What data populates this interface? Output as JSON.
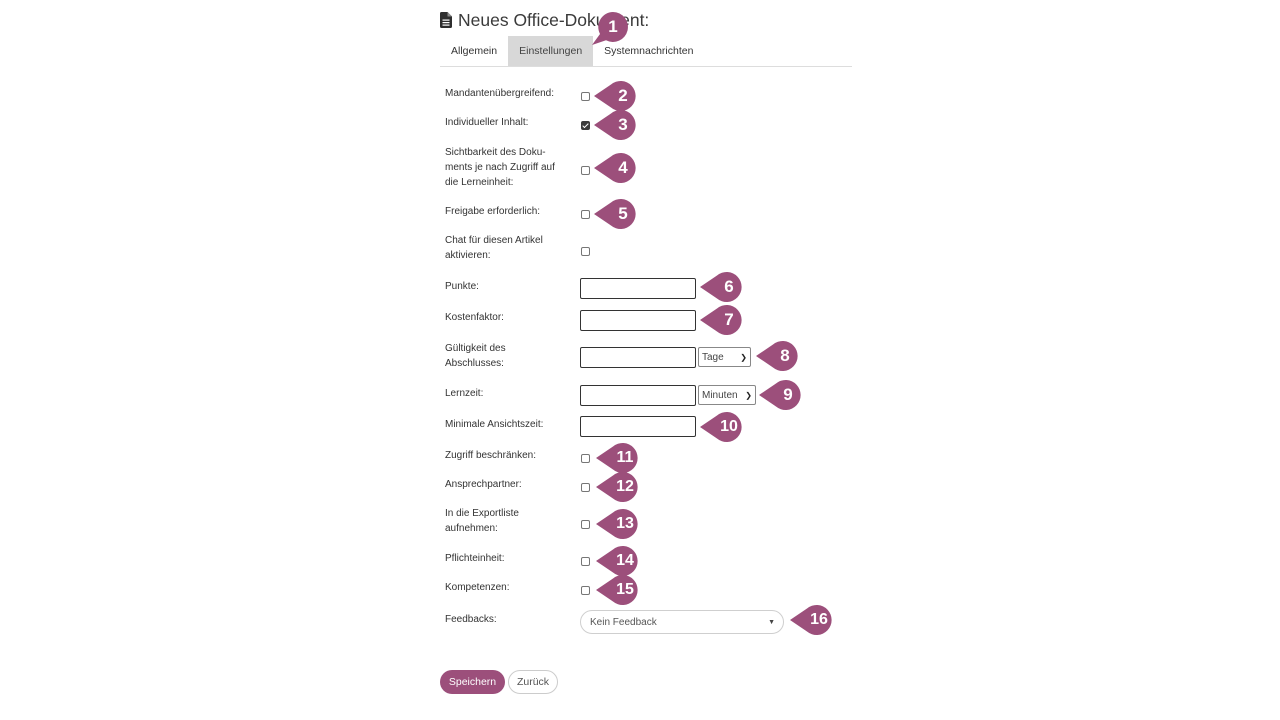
{
  "title": "Neues Office-Dokument:",
  "tabs": [
    {
      "label": "Allgemein"
    },
    {
      "label": "Einstellungen"
    },
    {
      "label": "Systemnachrichten"
    }
  ],
  "fields": {
    "mandanten": {
      "label": "Mandantenübergreifend:",
      "checked": false
    },
    "individuell": {
      "label": "Individueller Inhalt:",
      "checked": true
    },
    "sichtbarkeit": {
      "label": "Sichtbarkeit des Doku-\nments je nach Zugriff auf\ndie Lerneinheit:",
      "checked": false
    },
    "freigabe": {
      "label": "Freigabe erforderlich:",
      "checked": false
    },
    "chat": {
      "label": "Chat für diesen Artikel\naktivieren:",
      "checked": false
    },
    "punkte": {
      "label": "Punkte:",
      "value": ""
    },
    "kostenfaktor": {
      "label": "Kostenfaktor:",
      "value": ""
    },
    "gueltigkeit": {
      "label": "Gültigkeit des\nAbschlusses:",
      "value": "",
      "unit": "Tage"
    },
    "lernzeit": {
      "label": "Lernzeit:",
      "value": "",
      "unit": "Minuten"
    },
    "ansichtszeit": {
      "label": "Minimale Ansichtszeit:",
      "value": ""
    },
    "zugriff": {
      "label": "Zugriff beschränken:",
      "checked": false
    },
    "ansprechpartner": {
      "label": "Ansprechpartner:",
      "checked": false
    },
    "exportliste": {
      "label": "In die Exportliste\naufnehmen:",
      "checked": false
    },
    "pflicht": {
      "label": "Pflichteinheit:",
      "checked": false
    },
    "kompetenzen": {
      "label": "Kompetenzen:",
      "checked": false
    },
    "feedbacks": {
      "label": "Feedbacks:",
      "value": "Kein Feedback"
    }
  },
  "markers": [
    "1",
    "2",
    "3",
    "4",
    "5",
    "6",
    "7",
    "8",
    "9",
    "10",
    "11",
    "12",
    "13",
    "14",
    "15",
    "16"
  ],
  "buttons": {
    "save": "Speichern",
    "back": "Zurück"
  },
  "colors": {
    "accent": "#9c4f7b",
    "tab_active": "#d8d8d8"
  },
  "icons": {
    "title": "document-icon",
    "select": "chevron-down-icon",
    "feedback": "caret-down-icon"
  }
}
